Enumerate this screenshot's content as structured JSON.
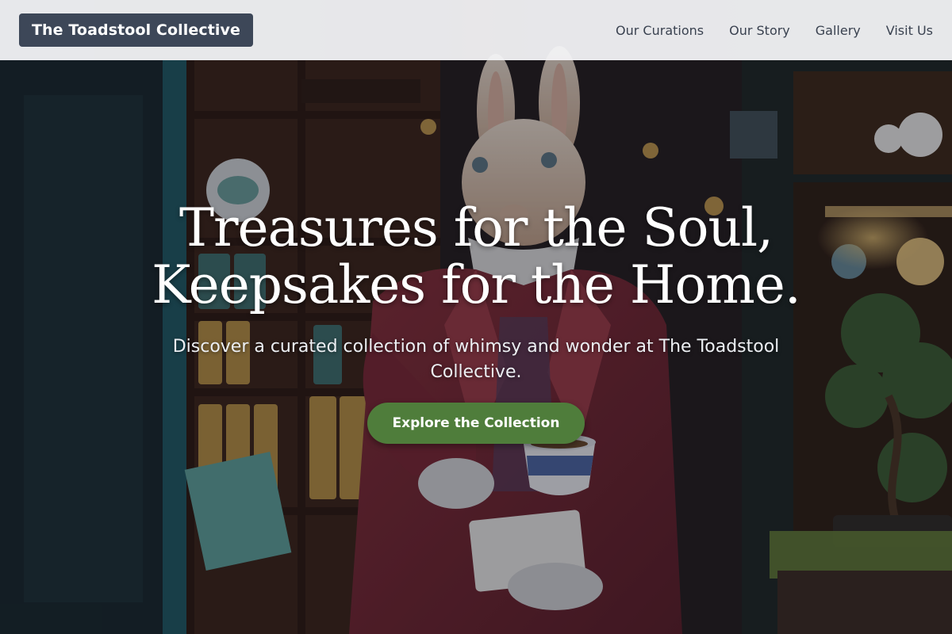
{
  "header": {
    "logo_label": "The Toadstool Collective",
    "nav": [
      {
        "label": "Our Curations"
      },
      {
        "label": "Our Story"
      },
      {
        "label": "Gallery"
      },
      {
        "label": "Visit Us"
      }
    ]
  },
  "hero": {
    "title": "Treasures for the Soul, Keepsakes for the Home.",
    "subtitle": "Discover a curated collection of whimsy and wonder at The Toadstool Collective.",
    "cta_label": "Explore the Collection"
  },
  "colors": {
    "header_bg": "#f4f4f6",
    "logo_bg": "#3d4758",
    "nav_text": "#3a4250",
    "cta_bg": "#4f7d3b"
  },
  "background_image": {
    "subject": "white rabbit figure in a red coat holding a teacup inside a curio shop"
  }
}
